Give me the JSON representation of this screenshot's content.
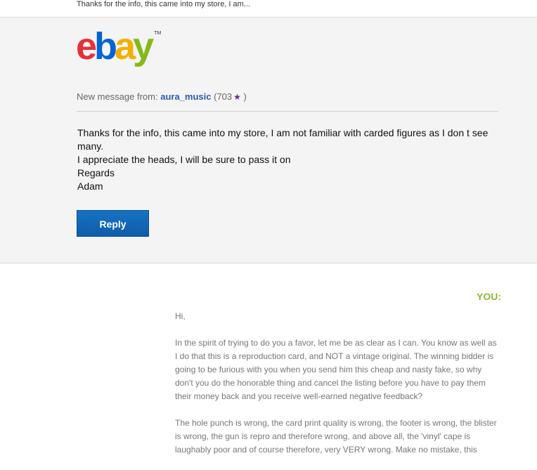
{
  "preheader": {
    "text": "Thanks for the info, this came into my store, I am..."
  },
  "logo": {
    "letters": [
      "e",
      "b",
      "a",
      "y"
    ],
    "colors": [
      "#e53238",
      "#0064d2",
      "#f5af02",
      "#86b817"
    ],
    "tm": "TM"
  },
  "message": {
    "from_label": "New message from:",
    "username": "aura_music",
    "feedback_open": "(703",
    "feedback_close": ")",
    "star_icon": "purple-star-icon",
    "lines": [
      "Thanks for the info, this came into my store, I am not familiar with carded figures as I don t see many.",
      "I appreciate the heads, I will be sure to pass it on",
      "Regards",
      "Adam"
    ],
    "reply_label": "Reply"
  },
  "quoted": {
    "you_label": "YOU:",
    "paragraphs": [
      "Hi,",
      "In the spirit of trying to do you a favor, let me be as clear as I can. You know as well as I do that this is a reproduction card, and NOT a vintage original. The winning bidder is going to be furious with you when you send him this cheap and nasty fake, so why don't you do the honorable thing and cancel the listing before you have to pay them their money back and you receive well-earned negative feedback?",
      "The hole punch is wrong, the card print quality is wrong, the footer is wrong, the blister is wrong, the gun is repro and therefore wrong, and above all, the 'vinyl' cape is laughably poor and of course therefore, very VERY wrong. Make no mistake, this"
    ]
  }
}
